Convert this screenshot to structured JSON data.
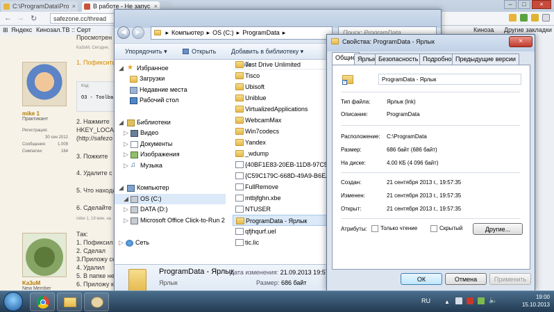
{
  "browser": {
    "tab1": "C:\\ProgramData\\Pro",
    "tab2": "В работе - Не запус",
    "url": "safezone.cc/thread",
    "bookmarks": [
      "Яндекс",
      "Кинозал.TB :: Серт",
      "Кинозал.ТВ - Серт"
    ],
    "other_bookmarks": "Другие закладки"
  },
  "forum": {
    "top_text": "Просмотрен",
    "meta": "Ka3uM, Сегодня,",
    "user1": {
      "name": "mike 1",
      "rank": "Практикант",
      "reg_label": "Регистрация:",
      "reg": "30 сен 2012",
      "msgs_label": "Сообщения:",
      "msgs": "1.009",
      "likes_label": "Симпатии:",
      "likes": "164"
    },
    "lines1": [
      "1. Пофиксить",
      "Код:",
      "O3 - Toolba",
      "2. Нажмите",
      "HKEY_LOCA",
      "(http://safezo",
      "3. Пожките",
      "4. Удалите с",
      "5. Что находи",
      "6. Сделайте"
    ],
    "meta2": "mike 1, 19 мин. на",
    "lines2": [
      "Так:",
      "1. Пофиксил",
      "2. Сделал",
      "3.Приложу ск",
      "4. Удалил",
      "5. В папке не",
      "6. Приложу ка"
    ],
    "user2": {
      "name": "Ka3uM",
      "rank": "New Member"
    }
  },
  "explorer": {
    "breadcrumb": [
      "Компьютер",
      "OS (C:)",
      "ProgramData"
    ],
    "search_placeholder": "Поиск: ProgramData",
    "toolbar": {
      "organize": "Упорядочить",
      "open": "Открыть",
      "add_library": "Добавить в библиотеку"
    },
    "nav": {
      "favorites": "Избранное",
      "downloads": "Загрузки",
      "recent": "Недавние места",
      "desktop": "Рабочий стол",
      "libraries": "Библиотеки",
      "video": "Видео",
      "documents": "Документы",
      "images": "Изображения",
      "music": "Музыка",
      "computer": "Компьютер",
      "os": "OS (C:)",
      "data": "DATA (D:)",
      "msoffice": "Microsoft Office Click-to-Run 2",
      "network": "Сеть"
    },
    "col_name": "Имя",
    "files": [
      "Test Drive Unlimited",
      "Tisco",
      "Ubisoft",
      "Uniblue",
      "VirtualizedApplications",
      "WebcamMax",
      "Win7codecs",
      "Yandex",
      "_wdump",
      "{40BF1E83-20EB-11D8-97C5-0",
      "{C59C179C-668D-49A9-B6EA-",
      "FullRemove",
      "mtbjfghn.xbe",
      "NTUSER",
      "ProgramData - Ярлык",
      "qfjhqurf.uel",
      "tic.lic"
    ],
    "details": {
      "name": "ProgramData - Ярлык",
      "type": "Ярлык",
      "modified_label": "Дата изменения:",
      "modified": "21.09.2013 19:57",
      "size_label": "Размер:",
      "size": "686 байт"
    }
  },
  "props": {
    "title": "Свойства: ProgramData - Ярлык",
    "tabs": [
      "Общие",
      "Ярлык",
      "Безопасность",
      "Подробно",
      "Предыдущие версии"
    ],
    "name": "ProgramData - Ярлык",
    "rows1": [
      {
        "k": "Тип файла:",
        "v": "Ярлык (lnk)"
      },
      {
        "k": "Описание:",
        "v": "ProgramData"
      }
    ],
    "rows2": [
      {
        "k": "Расположение:",
        "v": "C:\\ProgramData"
      },
      {
        "k": "Размер:",
        "v": "686 байт (686 байт)"
      },
      {
        "k": "На диске:",
        "v": "4.00 КБ (4 096 байт)"
      }
    ],
    "rows3": [
      {
        "k": "Создан:",
        "v": "21 сентября 2013 г., 19:57:35"
      },
      {
        "k": "Изменен:",
        "v": "21 сентября 2013 г., 19:57:35"
      },
      {
        "k": "Открыт:",
        "v": "21 сентября 2013 г., 19:57:35"
      }
    ],
    "attrs_label": "Атрибуты:",
    "readonly": "Только чтение",
    "hidden": "Скрытый",
    "other_btn": "Другие...",
    "ok": "ОК",
    "cancel": "Отмена",
    "apply": "Применить"
  },
  "taskbar": {
    "lang": "RU",
    "time": "19:00",
    "date": "15.10.2013"
  }
}
